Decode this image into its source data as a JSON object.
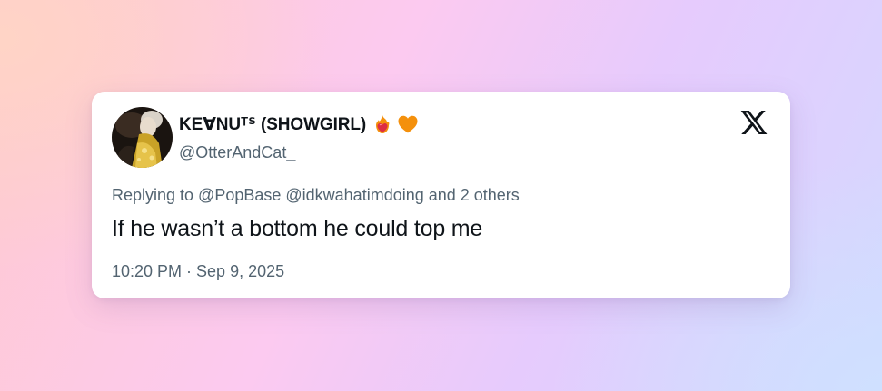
{
  "tweet": {
    "display_name": "KEꓯNUᵀᔆ (SHOWGIRL)",
    "emojis": [
      "heart-on-fire-icon",
      "orange-heart-icon"
    ],
    "handle": "@OtterAndCat_",
    "replying_to": "Replying to @PopBase @idkwahatimdoing and 2 others",
    "text": "If he wasn’t a bottom he could top me",
    "timestamp": "10:20 PM · Sep 9, 2025",
    "platform_icon": "x-logo-icon"
  },
  "colors": {
    "primary_text": "#0f1419",
    "secondary_text": "#536471",
    "card_background": "#ffffff",
    "orange_heart": "#f4900c",
    "fire_heart": "#dd2e44"
  }
}
